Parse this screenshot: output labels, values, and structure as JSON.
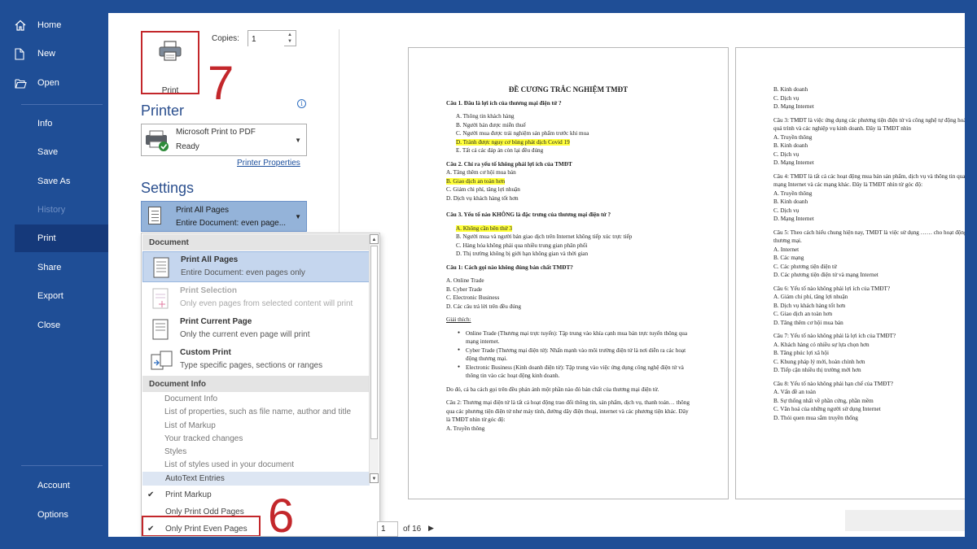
{
  "nav": {
    "home": "Home",
    "new": "New",
    "open": "Open",
    "info": "Info",
    "save": "Save",
    "save_as": "Save As",
    "history": "History",
    "print": "Print",
    "share": "Share",
    "export": "Export",
    "close": "Close",
    "account": "Account",
    "options": "Options"
  },
  "print_button": {
    "label": "Print"
  },
  "annotations": {
    "step7": "7",
    "step6": "6"
  },
  "copies": {
    "label": "Copies:",
    "value": "1"
  },
  "printer": {
    "heading": "Printer",
    "name": "Microsoft Print to PDF",
    "status": "Ready",
    "properties_link": "Printer Properties"
  },
  "settings": {
    "heading": "Settings",
    "selected_title": "Print All Pages",
    "selected_sub": "Entire Document: even page..."
  },
  "menu": {
    "document_header": "Document",
    "items": [
      {
        "title": "Print All Pages",
        "sub": "Entire Document: even pages only"
      },
      {
        "title": "Print Selection",
        "sub": "Only even pages from selected content will print"
      },
      {
        "title": "Print Current Page",
        "sub": "Only the current even page will print"
      },
      {
        "title": "Custom Print",
        "sub": "Type specific pages, sections or ranges"
      }
    ],
    "docinfo_header": "Document Info",
    "docinfo": [
      "Document Info",
      "List of properties, such as file name, author and title",
      "List of Markup",
      "Your tracked changes",
      "Styles",
      "List of styles used in your document",
      "AutoText Entries"
    ],
    "print_markup": "Print Markup",
    "odd_pages": "Only Print Odd Pages",
    "even_pages": "Only Print Even Pages"
  },
  "pager": {
    "current": "1",
    "of_label": "of 16"
  },
  "page1": {
    "title": "ĐỀ CƯƠNG TRẮC NGHIỆM TMĐT",
    "q1": "Câu 1. Đâu là lợi ích của thương mại điện tử ?",
    "q1_opts": [
      "A.  Thông tin khách hàng",
      "B.  Người bán được miễn thuế",
      "C.  Người mua được trải nghiệm sản phẩm trước khi mua",
      "D.  Tránh được nguy cơ bùng phát dịch Covid 19",
      "E.  Tất cả các đáp án còn lại đều đúng"
    ],
    "q2": "Câu 2. Chỉ ra yếu tố không phải lợi ích của TMĐT",
    "q2_opts": [
      "A. Tăng thêm cơ hội mua bán",
      "B. Giao dịch an toàn hơn",
      "C. Giảm chi phí, tăng lợi nhuận",
      "D. Dịch vụ khách hàng tốt hơn"
    ],
    "q3": "Câu 3. Yếu tố nào KHÔNG là đặc trưng của thương mại điện tử ?",
    "q3_opts": [
      "A.  Không cần bên thứ 3",
      "B.  Người mua và người bán giao dịch trên Internet không tiếp xúc trực tiếp",
      "C.  Hàng hóa không phải qua nhiều trung gian phân phối",
      "D.  Thị trường không bị giới hạn không gian và thời gian"
    ],
    "q4": "Câu 1: Cách gọi nào không đúng bản chất TMĐT?",
    "q4_opts": [
      "A. Online Trade",
      "B. Cyber Trade",
      "C. Electronic Business",
      "D. Các câu trả lời trên đều đúng"
    ],
    "explain_label": "Giải thích:",
    "bullets": [
      "Online Trade (Thương mại trực tuyến): Tập trung vào khía cạnh mua bán trực tuyến thông qua mạng internet.",
      "Cyber Trade (Thương mại điện tử): Nhấn mạnh vào môi trường điện tử là nơi diễn ra các hoạt động thương mại.",
      "Electronic Business (Kinh doanh điện tử): Tập trung vào việc ứng dụng công nghệ điện tử và thông tin vào các hoạt động kinh doanh."
    ],
    "conclusion": "Do đó, cả ba cách gọi trên đều phản ánh một phần nào đó bản chất của thương mại điện tử.",
    "q5": "Câu 2: Thương mại điện tử là tất cả hoạt động trao đổi thông tin, sản phẩm, dịch vụ, thanh toán… thông qua các phương tiện điện tử như máy tính, đường dây điện thoại, internet và các phương tiện khác. Đây là TMĐT nhìn từ góc độ:",
    "q5_opt": "A. Truyền thông"
  },
  "page2": {
    "top_opts": [
      "B. Kinh doanh",
      "C. Dịch vụ",
      "D. Mạng Internet"
    ],
    "q3": "Câu 3: TMĐT là việc ứng dụng các phương tiện điện tử và công nghệ tự động hoá quá trình và các nghiệp vụ kinh doanh. Đây là TMĐT nhìn",
    "q3_opts": [
      "A. Truyền thông",
      "B. Kinh doanh",
      "C. Dịch vụ",
      "D. Mạng Internet"
    ],
    "q4": "Câu 4: TMĐT là tất cả các hoạt động mua bán sản phẩm, dịch vụ và thông tin qua mạng Internet và các mạng khác. Đây là TMĐT nhìn từ góc độ:",
    "q4_opts": [
      "A. Truyền thông",
      "B. Kinh doanh",
      "C. Dịch vụ",
      "D. Mạng Internet"
    ],
    "q5": "Câu 5: Theo cách hiểu chung hiện nay, TMĐT là việc sử dụng …… cho hoạt động thương mại.",
    "q5_opts": [
      "A. Internet",
      "B. Các mạng",
      "C. Các phương tiện điện tử",
      "D. Các phương tiện điện tử và mạng Internet"
    ],
    "q6": "Câu 6: Yếu tố nào không phải lợi ích của TMĐT?",
    "q6_opts": [
      "A. Giảm chi phí, tăng lợi nhuận",
      "B. Dịch vụ khách hàng tốt hơn",
      "C. Giao dịch an toàn hơn",
      "D. Tăng thêm cơ hội mua bán"
    ],
    "q7": "Câu 7: Yếu tố nào không phải là lợi ích của TMĐT?",
    "q7_opts": [
      "A. Khách hàng có nhiều sự lựa chọn hơn",
      "B. Tăng phúc lợi xã hội",
      "C. Khung pháp lý mới, hoàn chỉnh hơn",
      "D. Tiếp cận nhiều thị trường mới hơn"
    ],
    "q8": "Câu 8: Yếu tố nào không phải hạn chế của TMĐT?",
    "q8_opts": [
      "A. Vấn đề an toàn",
      "B. Sự thống nhất về phần cứng, phần mềm",
      "C. Văn hoá của những người sử dụng Internet",
      "D. Thói quen mua sắm truyền thống"
    ]
  },
  "colors": {
    "nav_bg": "#1f4e96",
    "accent_red": "#c3272b",
    "highlight": "#ffff3a",
    "selected_bg": "#94b3d9"
  }
}
